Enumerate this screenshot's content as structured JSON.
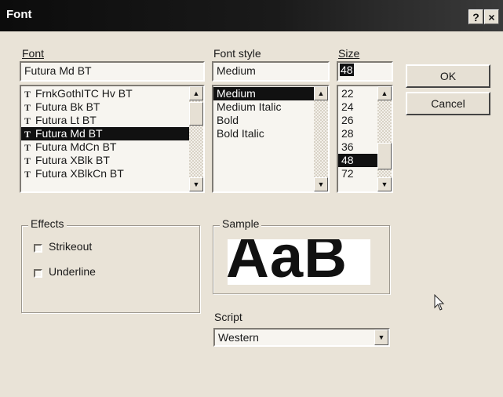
{
  "dialog": {
    "title": "Font",
    "help_button": "?",
    "close_button": "×"
  },
  "font": {
    "label": "Font",
    "value": "Futura Md BT",
    "items": [
      {
        "name": "FrnkGothITC Hv BT",
        "selected": false
      },
      {
        "name": "Futura Bk BT",
        "selected": false
      },
      {
        "name": "Futura Lt BT",
        "selected": false
      },
      {
        "name": "Futura Md BT",
        "selected": true
      },
      {
        "name": "Futura MdCn BT",
        "selected": false
      },
      {
        "name": "Futura XBlk BT",
        "selected": false
      },
      {
        "name": "Futura XBlkCn BT",
        "selected": false
      }
    ]
  },
  "font_style": {
    "label": "Font style",
    "value": "Medium",
    "items": [
      {
        "name": "Medium",
        "selected": true
      },
      {
        "name": "Medium Italic",
        "selected": false
      },
      {
        "name": "Bold",
        "selected": false
      },
      {
        "name": "Bold Italic",
        "selected": false
      }
    ]
  },
  "size": {
    "label": "Size",
    "value": "48",
    "items": [
      {
        "name": "22",
        "selected": false
      },
      {
        "name": "24",
        "selected": false
      },
      {
        "name": "26",
        "selected": false
      },
      {
        "name": "28",
        "selected": false
      },
      {
        "name": "36",
        "selected": false
      },
      {
        "name": "48",
        "selected": true
      },
      {
        "name": "72",
        "selected": false
      }
    ]
  },
  "buttons": {
    "ok": "OK",
    "cancel": "Cancel"
  },
  "effects": {
    "label": "Effects",
    "strikeout": "Strikeout",
    "underline": "Underline",
    "strikeout_checked": false,
    "underline_checked": false
  },
  "sample": {
    "label": "Sample",
    "text": "AaB"
  },
  "script": {
    "label": "Script",
    "value": "Western"
  }
}
